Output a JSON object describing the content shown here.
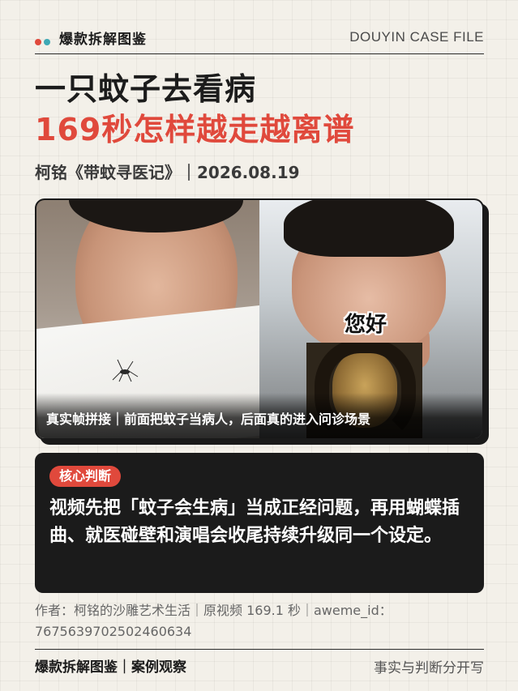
{
  "header": {
    "brand": "爆款拆解图鉴",
    "case_file": "DOUYIN CASE FILE",
    "dot_colors": [
      "#e0493c",
      "#3fa9b5"
    ]
  },
  "title": {
    "line1": "一只蚊子去看病",
    "line2": "169秒怎样越走越离谱",
    "subtitle": "柯铭《带蚊寻医记》｜2026.08.19"
  },
  "frames": {
    "overlay_text": "您好",
    "caption": "真实帧拼接｜前面把蚊子当病人，后面真的进入问诊场景"
  },
  "judgment": {
    "badge": "核心判断",
    "text": "视频先把「蚊子会生病」当成正经问题，再用蝴蝶插曲、就医碰壁和演唱会收尾持续升级同一个设定。"
  },
  "meta": {
    "text": "作者：柯铭的沙雕艺术生活｜原视频 169.1 秒｜aweme_id：7675639702502460634"
  },
  "footer": {
    "left": "爆款拆解图鉴｜案例观察",
    "right": "事实与判断分开写"
  },
  "colors": {
    "accent": "#e0493c",
    "dark": "#1b1b1b",
    "background": "#f3f0e9"
  }
}
